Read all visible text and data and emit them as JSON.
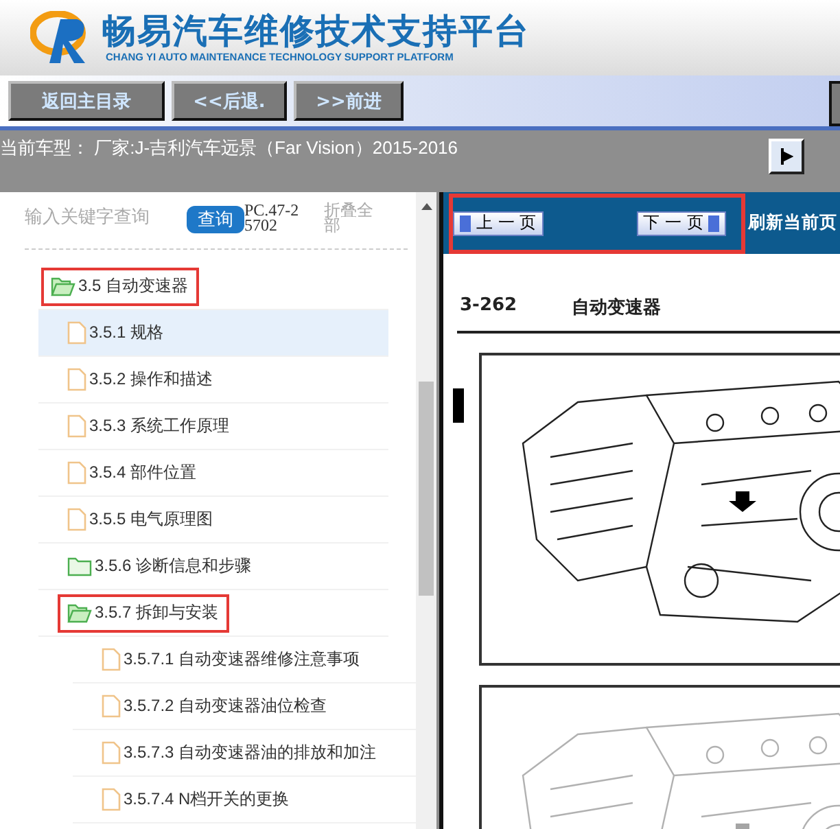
{
  "header": {
    "title": "畅易汽车维修技术支持平台",
    "subtitle": "CHANG YI AUTO MAINTENANCE TECHNOLOGY SUPPORT PLATFORM"
  },
  "toolbar": {
    "buttons": [
      "返回主目录",
      "<<后退.",
      ">>前进"
    ]
  },
  "vehicle_bar": {
    "text": "当前车型： 厂家:J-吉利汽车远景（Far Vision）2015-2016"
  },
  "search": {
    "placeholder": "输入关键字查询",
    "button": "查询",
    "code": "PC.47-25702",
    "collapse": "折叠全部"
  },
  "tree": [
    {
      "label": "3.5 自动变速器",
      "kind": "folder",
      "expanded": true,
      "selected": false,
      "highlighted": true,
      "children": [
        {
          "label": "3.5.1 规格",
          "kind": "page",
          "selected": true,
          "highlighted": false
        },
        {
          "label": "3.5.2 操作和描述",
          "kind": "page",
          "selected": false,
          "highlighted": false
        },
        {
          "label": "3.5.3 系统工作原理",
          "kind": "page",
          "selected": false,
          "highlighted": false
        },
        {
          "label": "3.5.4 部件位置",
          "kind": "page",
          "selected": false,
          "highlighted": false
        },
        {
          "label": "3.5.5 电气原理图",
          "kind": "page",
          "selected": false,
          "highlighted": false
        },
        {
          "label": "3.5.6 诊断信息和步骤",
          "kind": "folder",
          "expanded": false,
          "selected": false,
          "highlighted": false
        },
        {
          "label": "3.5.7 拆卸与安装",
          "kind": "folder",
          "expanded": true,
          "selected": false,
          "highlighted": true,
          "children": [
            {
              "label": "3.5.7.1 自动变速器维修注意事项",
              "kind": "page",
              "selected": false,
              "highlighted": false
            },
            {
              "label": "3.5.7.2 自动变速器油位检查",
              "kind": "page",
              "selected": false,
              "highlighted": false
            },
            {
              "label": "3.5.7.3 自动变速器油的排放和加注",
              "kind": "page",
              "selected": false,
              "highlighted": false
            },
            {
              "label": "3.5.7.4 N档开关的更换",
              "kind": "page",
              "selected": false,
              "highlighted": false
            }
          ]
        }
      ]
    }
  ],
  "viewer": {
    "prev": "上 一 页",
    "next": "下 一 页",
    "pager_highlighted": true,
    "refresh": "刷新当前页",
    "page_number": "3-262",
    "page_title": "自动变速器"
  }
}
